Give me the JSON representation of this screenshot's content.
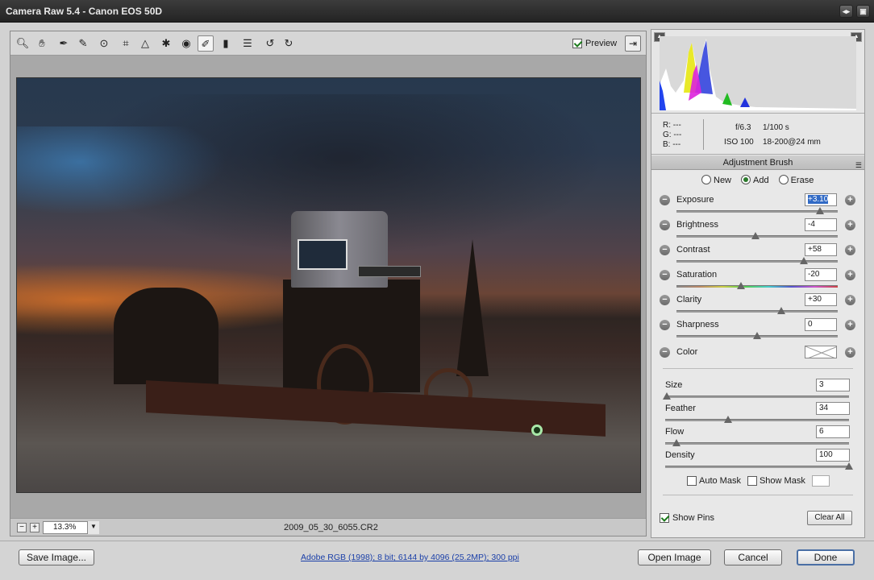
{
  "window": {
    "title": "Camera Raw 5.4  -  Canon EOS 50D"
  },
  "toolbar": {
    "tools": [
      "zoom-tool-icon",
      "hand-tool-icon",
      "white-balance-tool-icon",
      "color-sampler-icon",
      "target-adjustment-icon",
      "crop-icon",
      "straighten-icon",
      "spot-removal-icon",
      "red-eye-icon",
      "adjustment-brush-icon",
      "graduated-filter-icon",
      "preferences-icon",
      "rotate-ccw-icon",
      "rotate-cw-icon"
    ],
    "preview_label": "Preview",
    "preview_checked": true
  },
  "image_view": {
    "zoom": "13.3%",
    "filename": "2009_05_30_6055.CR2"
  },
  "histogram": {
    "readout": {
      "r": "R:  ---",
      "g": "G:  ---",
      "b": "B:  ---"
    },
    "aperture": "f/6.3",
    "shutter": "1/100 s",
    "iso": "ISO 100",
    "lens": "18-200@24 mm"
  },
  "panel": {
    "title": "Adjustment Brush",
    "modes": [
      {
        "label": "New",
        "selected": false
      },
      {
        "label": "Add",
        "selected": true
      },
      {
        "label": "Erase",
        "selected": false
      }
    ],
    "adjustments": [
      {
        "label": "Exposure",
        "value": "+3.10",
        "fraction": 0.89
      },
      {
        "label": "Brightness",
        "value": "-4",
        "fraction": 0.49
      },
      {
        "label": "Contrast",
        "value": "+58",
        "fraction": 0.79
      },
      {
        "label": "Saturation",
        "value": "-20",
        "fraction": 0.4
      },
      {
        "label": "Clarity",
        "value": "+30",
        "fraction": 0.65
      },
      {
        "label": "Sharpness",
        "value": "0",
        "fraction": 0.5
      }
    ],
    "color_label": "Color",
    "brush": [
      {
        "label": "Size",
        "value": "3",
        "fraction": 0.01
      },
      {
        "label": "Feather",
        "value": "34",
        "fraction": 0.34
      },
      {
        "label": "Flow",
        "value": "6",
        "fraction": 0.06
      },
      {
        "label": "Density",
        "value": "100",
        "fraction": 1.0
      }
    ],
    "auto_mask_label": "Auto Mask",
    "show_mask_label": "Show Mask",
    "show_pins_label": "Show Pins",
    "clear_all_label": "Clear All"
  },
  "footer": {
    "save_label": "Save Image...",
    "workflow_link": "Adobe RGB (1998); 8 bit; 6144 by 4096 (25.2MP); 300 ppi",
    "open_label": "Open Image",
    "cancel_label": "Cancel",
    "done_label": "Done"
  },
  "colors": {
    "accent_selection": "#316ac5",
    "link": "#1a3fa8",
    "pin": "#a8e8a8"
  }
}
